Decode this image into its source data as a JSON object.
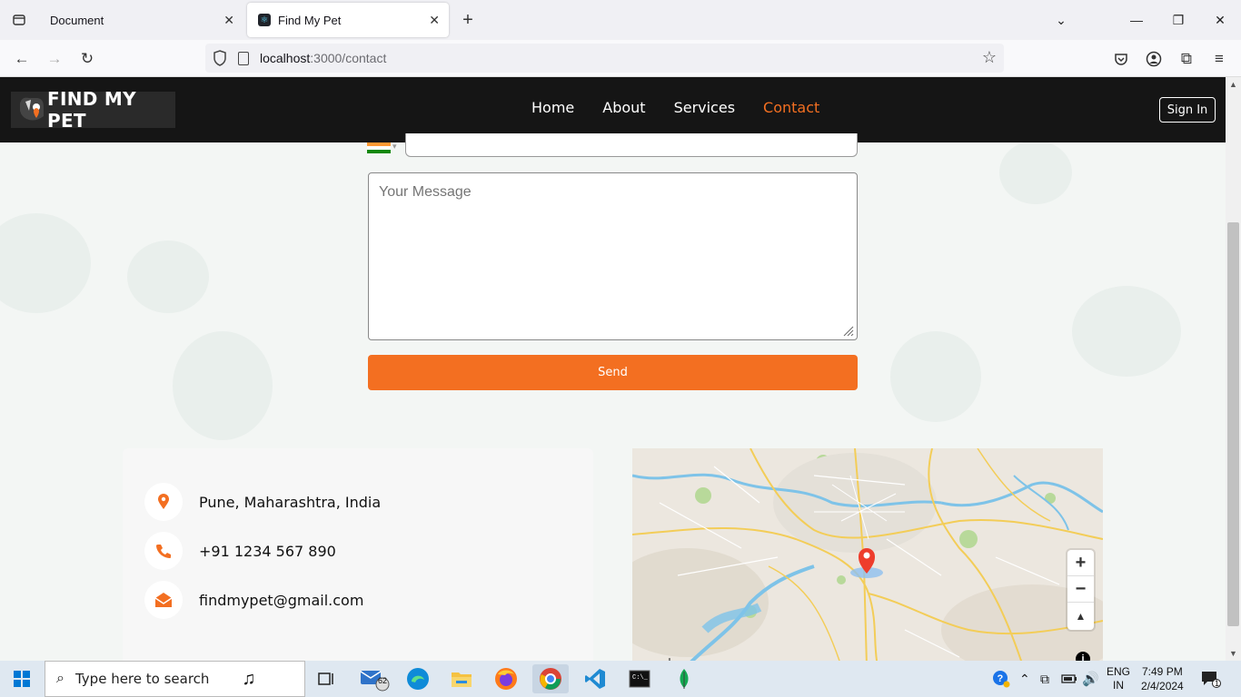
{
  "browser": {
    "tabs": [
      {
        "title": "Document",
        "active": false
      },
      {
        "title": "Find My Pet",
        "active": true
      }
    ],
    "url_host": "localhost",
    "url_rest": ":3000/contact"
  },
  "site": {
    "logo_text": "FIND MY PET",
    "nav": [
      {
        "label": "Home",
        "active": false
      },
      {
        "label": "About",
        "active": false
      },
      {
        "label": "Services",
        "active": false
      },
      {
        "label": "Contact",
        "active": true
      }
    ],
    "sign_in_label": "Sign In"
  },
  "form": {
    "message_placeholder": "Your Message",
    "send_label": "Send"
  },
  "contact": {
    "address": "Pune, Maharashtra, India",
    "phone": "+91 1234 567 890",
    "email": "findmypet@gmail.com"
  },
  "map": {
    "attribution_logo": "mapbox",
    "zoom_in": "+",
    "zoom_out": "−"
  },
  "taskbar": {
    "search_placeholder": "Type here to search",
    "mail_badge": "62",
    "lang_primary": "ENG",
    "lang_secondary": "IN",
    "time": "7:49 PM",
    "date": "2/4/2024",
    "notification_count": "1"
  },
  "colors": {
    "accent": "#f36f21",
    "header_bg": "#151515"
  }
}
